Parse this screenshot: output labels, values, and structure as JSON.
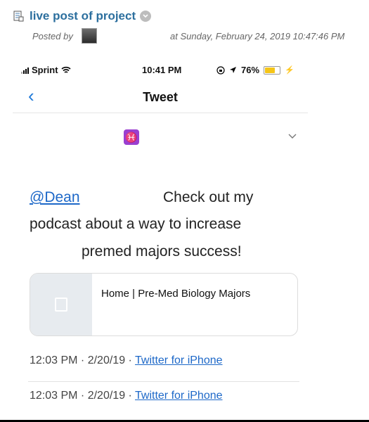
{
  "post": {
    "title": "live post of project",
    "posted_by": "Posted by",
    "posted_at": "at Sunday, February 24, 2019 10:47:46 PM"
  },
  "phone": {
    "carrier": "Sprint",
    "time": "10:41 PM",
    "battery_pct": "76%",
    "battery_level": 0.76,
    "back_icon": "chevron-left-icon",
    "nav_title": "Tweet",
    "profile_badge": "♓",
    "more_icon": "chevron-down-icon"
  },
  "tweet": {
    "mention": "@Dean",
    "line1_rest": "Check out my",
    "line2": "podcast about a way to increase",
    "line3": "premed majors success!",
    "card_title": "Home | Pre-Med Biology Majors",
    "meta": [
      {
        "time": "12:03 PM · 2/20/19 · ",
        "source": "Twitter for iPhone"
      },
      {
        "time": "12:03 PM · 2/20/19 · ",
        "source": "Twitter for iPhone"
      }
    ]
  },
  "colors": {
    "link": "#1d68c8",
    "title": "#2c6f9e",
    "battery": "#f5c518",
    "badge": "#9a3fd0"
  }
}
